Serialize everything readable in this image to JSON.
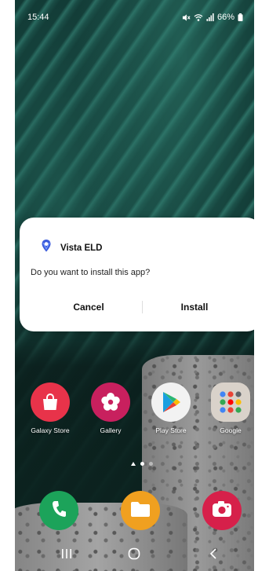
{
  "status_bar": {
    "time": "15:44",
    "battery": "66%"
  },
  "dialog": {
    "app_name": "Vista ELD",
    "question": "Do you want to install this app?",
    "cancel_label": "Cancel",
    "install_label": "Install"
  },
  "home_apps": [
    {
      "label": "Galaxy Store",
      "icon": "shopping-bag-icon",
      "color": "#e8334a"
    },
    {
      "label": "Gallery",
      "icon": "flower-icon",
      "color": "#c8205e"
    },
    {
      "label": "Play Store",
      "icon": "play-triangle-icon",
      "color": "#f2f2f2"
    },
    {
      "label": "Google",
      "icon": "folder-grid-icon",
      "color": "#d9d2ca"
    }
  ],
  "dock": [
    {
      "icon": "phone-icon",
      "color": "#1ca35a"
    },
    {
      "icon": "folder-icon",
      "color": "#f0a020"
    },
    {
      "icon": "camera-icon",
      "color": "#d6204a"
    }
  ],
  "page_indicator": {
    "pages": 2,
    "active": 1
  },
  "nav": {
    "recents": "recents-icon",
    "home": "home-icon",
    "back": "back-icon"
  }
}
